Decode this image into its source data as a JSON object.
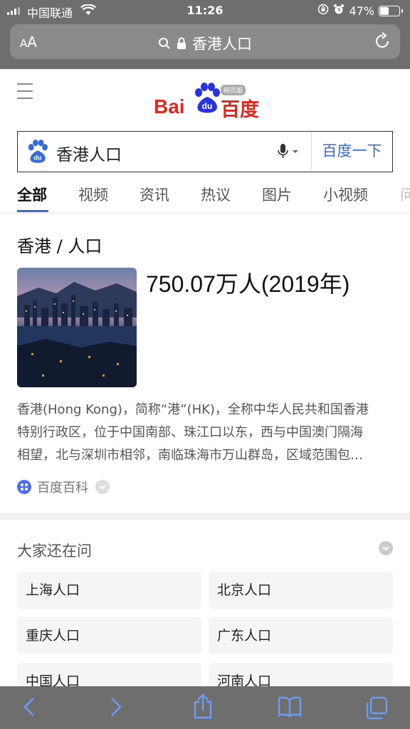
{
  "status": {
    "carrier": "中国联通",
    "time": "11:26",
    "battery": "47%",
    "battery_level": 0.47
  },
  "browser": {
    "text_size_label": "AA",
    "url_text": "香港人口"
  },
  "search": {
    "query": "香港人口",
    "button_label": "百度一下"
  },
  "tabs": [
    "全部",
    "视频",
    "资讯",
    "热议",
    "图片",
    "小视频",
    "问"
  ],
  "result": {
    "title": "香港 / 人口",
    "answer": "750.07万人(2019年)",
    "description_lines": [
      "香港(Hong Kong)，简称“港”(HK)，全称中华人民共和国香港",
      "特别行政区，位于中国南部、珠江口以东，西与中国澳门隔海",
      "相望，北与深圳市相邻，南临珠海市万山群岛，区域范围包…"
    ],
    "source": "百度百科"
  },
  "related": {
    "title": "大家还在问",
    "items": [
      "上海人口",
      "北京人口",
      "重庆人口",
      "广东人口",
      "中国人口",
      "河南人口"
    ]
  },
  "colors": {
    "accent": "#3a6ad6",
    "brand_red": "#de2920",
    "brand_blue": "#2932e1",
    "chrome": "#6e6e6e"
  }
}
